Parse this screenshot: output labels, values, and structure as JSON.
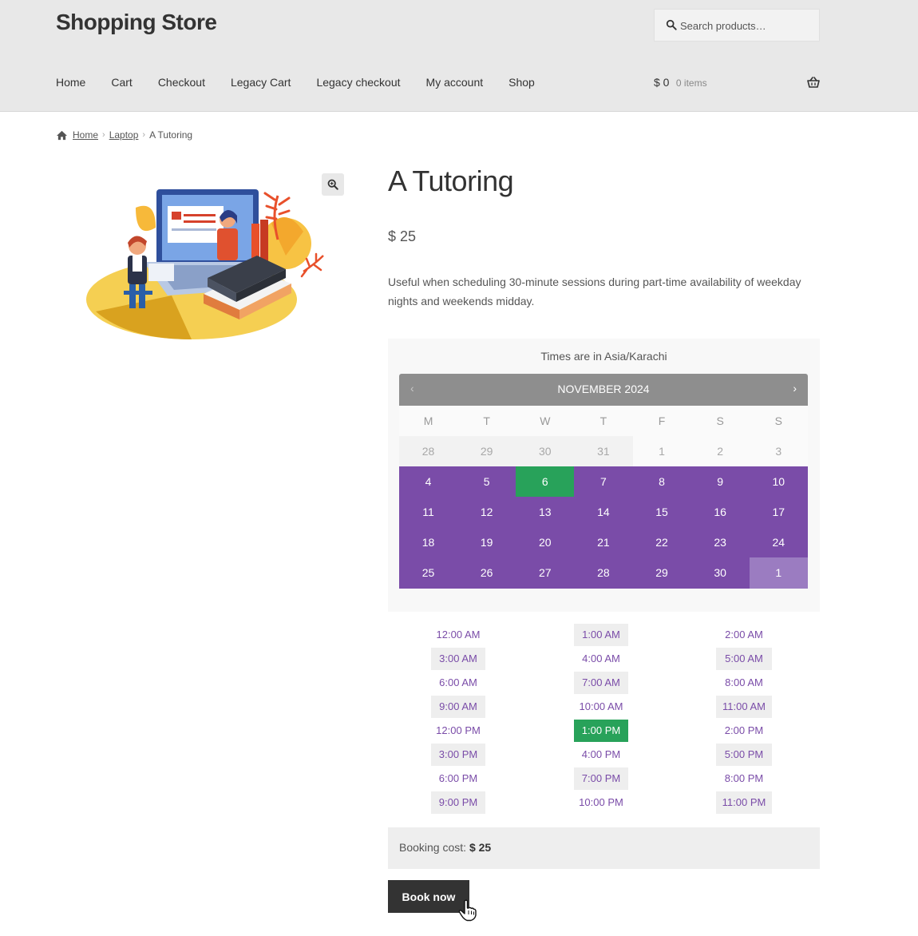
{
  "header": {
    "site_title": "Shopping Store",
    "search_placeholder": "Search products…",
    "nav": [
      "Home",
      "Cart",
      "Checkout",
      "Legacy Cart",
      "Legacy checkout",
      "My account",
      "Shop"
    ],
    "cart_amount": "$ 0",
    "cart_count": "0 items"
  },
  "breadcrumb": {
    "home": "Home",
    "category": "Laptop",
    "current": "A Tutoring"
  },
  "product": {
    "title": "A Tutoring",
    "price": "$ 25",
    "description": "Useful when scheduling 30-minute sessions during part-time availability of weekday nights and weekends midday."
  },
  "booking": {
    "timezone_note": "Times are in Asia/Karachi",
    "month": "NOVEMBER 2024",
    "weekdays": [
      "M",
      "T",
      "W",
      "T",
      "F",
      "S",
      "S"
    ],
    "days": [
      {
        "d": "28",
        "s": "past"
      },
      {
        "d": "29",
        "s": "past"
      },
      {
        "d": "30",
        "s": "past"
      },
      {
        "d": "31",
        "s": "past"
      },
      {
        "d": "1",
        "s": "na"
      },
      {
        "d": "2",
        "s": "na"
      },
      {
        "d": "3",
        "s": "na"
      },
      {
        "d": "4",
        "s": "avail"
      },
      {
        "d": "5",
        "s": "avail"
      },
      {
        "d": "6",
        "s": "sel"
      },
      {
        "d": "7",
        "s": "avail"
      },
      {
        "d": "8",
        "s": "avail"
      },
      {
        "d": "9",
        "s": "avail"
      },
      {
        "d": "10",
        "s": "avail"
      },
      {
        "d": "11",
        "s": "avail"
      },
      {
        "d": "12",
        "s": "avail"
      },
      {
        "d": "13",
        "s": "avail"
      },
      {
        "d": "14",
        "s": "avail"
      },
      {
        "d": "15",
        "s": "avail"
      },
      {
        "d": "16",
        "s": "avail"
      },
      {
        "d": "17",
        "s": "avail"
      },
      {
        "d": "18",
        "s": "avail"
      },
      {
        "d": "19",
        "s": "avail"
      },
      {
        "d": "20",
        "s": "avail"
      },
      {
        "d": "21",
        "s": "avail"
      },
      {
        "d": "22",
        "s": "avail"
      },
      {
        "d": "23",
        "s": "avail"
      },
      {
        "d": "24",
        "s": "avail"
      },
      {
        "d": "25",
        "s": "avail"
      },
      {
        "d": "26",
        "s": "avail"
      },
      {
        "d": "27",
        "s": "avail"
      },
      {
        "d": "28",
        "s": "avail"
      },
      {
        "d": "29",
        "s": "avail"
      },
      {
        "d": "30",
        "s": "avail"
      },
      {
        "d": "1",
        "s": "next-mo"
      }
    ],
    "times": [
      "12:00 AM",
      "1:00 AM",
      "2:00 AM",
      "3:00 AM",
      "4:00 AM",
      "5:00 AM",
      "6:00 AM",
      "7:00 AM",
      "8:00 AM",
      "9:00 AM",
      "10:00 AM",
      "11:00 AM",
      "12:00 PM",
      "1:00 PM",
      "2:00 PM",
      "3:00 PM",
      "4:00 PM",
      "5:00 PM",
      "6:00 PM",
      "7:00 PM",
      "8:00 PM",
      "9:00 PM",
      "10:00 PM",
      "11:00 PM"
    ],
    "selected_time": "1:00 PM",
    "cost_label": "Booking cost:",
    "cost_value": "$ 25",
    "book_button": "Book now"
  },
  "colors": {
    "available": "#7a4ca8",
    "selected": "#28a25a",
    "header_bg": "#e8e8e8"
  }
}
